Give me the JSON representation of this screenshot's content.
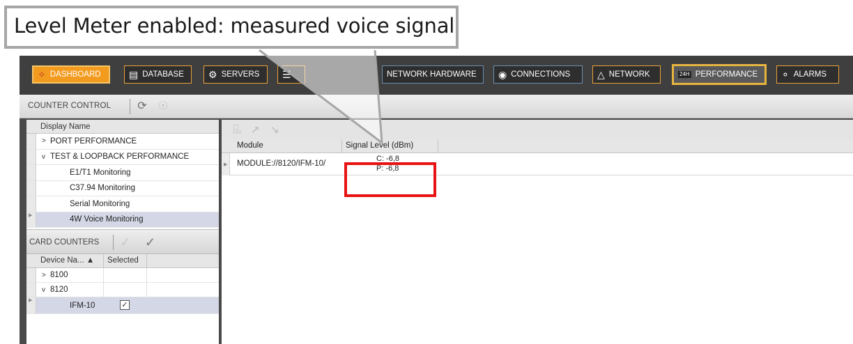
{
  "callout": {
    "text": "Level Meter enabled:  measured voice signal"
  },
  "nav": {
    "dashboard": "DASHBOARD",
    "database": "DATABASE",
    "servers": "SERVERS",
    "network_hardware": "NETWORK HARDWARE",
    "connections": "CONNECTIONS",
    "network": "NETWORK",
    "performance": "PERFORMANCE",
    "performance_icon_text": "24H",
    "alarms": "ALARMS"
  },
  "counter_control": {
    "label": "COUNTER CONTROL"
  },
  "tree": {
    "header": "Display Name",
    "items": [
      {
        "label": "PORT PERFORMANCE",
        "expander": ">"
      },
      {
        "label": "TEST & LOOPBACK PERFORMANCE",
        "expander": "v"
      },
      {
        "label": "E1/T1 Monitoring"
      },
      {
        "label": "C37.94 Monitoring"
      },
      {
        "label": "Serial Monitoring"
      },
      {
        "label": "4W Voice Monitoring"
      }
    ]
  },
  "card_counters": {
    "label": "CARD COUNTERS",
    "columns": [
      "Device Na... ▲",
      "Selected"
    ],
    "rows": [
      {
        "name": "8100",
        "expander": ">"
      },
      {
        "name": "8120",
        "expander": "v"
      },
      {
        "name": "IFM-10",
        "checked": "✓"
      }
    ]
  },
  "results": {
    "csv_icon_text": "CSV",
    "columns": [
      "Module",
      "Signal Level (dBm)"
    ],
    "rows": [
      {
        "module": "MODULE://8120/IFM-10/",
        "level_c": "C: -6,8",
        "level_p": "P: -6,8"
      }
    ]
  },
  "colors": {
    "highlight": "#e81414",
    "accent_orange": "#f39b1f",
    "callout_border": "#a6a6a6"
  }
}
